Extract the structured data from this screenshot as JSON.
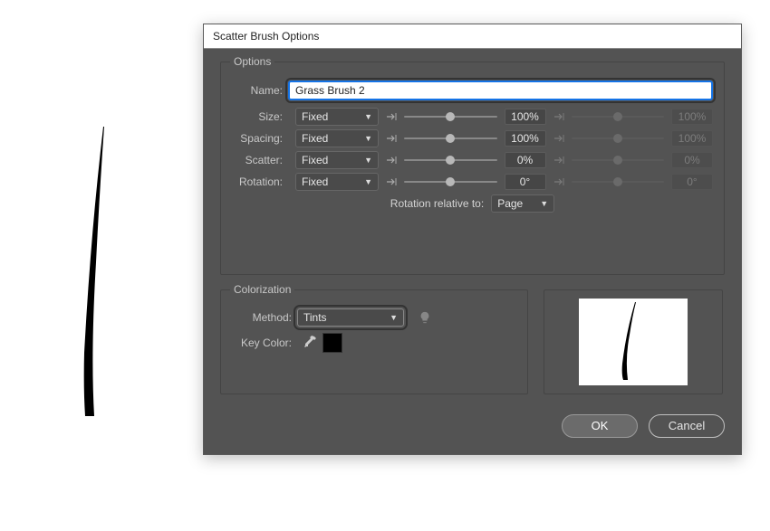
{
  "dialog": {
    "title": "Scatter Brush Options",
    "options_legend": "Options",
    "colorization_legend": "Colorization",
    "name_label": "Name:",
    "name_value": "Grass Brush 2",
    "params": [
      {
        "label": "Size:",
        "mode": "Fixed",
        "value": "100%",
        "value2": "100%",
        "pos": 50,
        "pos2": 50
      },
      {
        "label": "Spacing:",
        "mode": "Fixed",
        "value": "100%",
        "value2": "100%",
        "pos": 50,
        "pos2": 50
      },
      {
        "label": "Scatter:",
        "mode": "Fixed",
        "value": "0%",
        "value2": "0%",
        "pos": 50,
        "pos2": 50
      },
      {
        "label": "Rotation:",
        "mode": "Fixed",
        "value": "0°",
        "value2": "0°",
        "pos": 50,
        "pos2": 50
      }
    ],
    "rotation_relative_label": "Rotation relative to:",
    "rotation_relative_value": "Page",
    "method_label": "Method:",
    "method_value": "Tints",
    "keycolor_label": "Key Color:",
    "keycolor_value": "#000000",
    "ok_label": "OK",
    "cancel_label": "Cancel"
  }
}
